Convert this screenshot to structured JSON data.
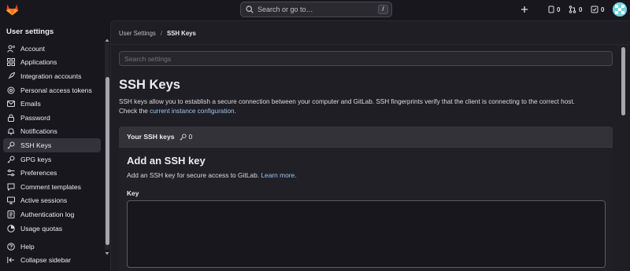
{
  "top_bar": {
    "search_placeholder": "Search or go to…",
    "search_shortcut": "/",
    "create_icon": "plus-icon",
    "merge_requests_count": "0",
    "issues_count": "0",
    "todos_count": "0"
  },
  "sidebar": {
    "title": "User settings",
    "items": [
      {
        "label": "Account",
        "icon": "account-icon"
      },
      {
        "label": "Applications",
        "icon": "applications-icon"
      },
      {
        "label": "Integration accounts",
        "icon": "rocket-icon"
      },
      {
        "label": "Personal access tokens",
        "icon": "token-icon"
      },
      {
        "label": "Emails",
        "icon": "mail-icon"
      },
      {
        "label": "Password",
        "icon": "lock-icon"
      },
      {
        "label": "Notifications",
        "icon": "bell-icon"
      },
      {
        "label": "SSH Keys",
        "icon": "key-icon",
        "active": true
      },
      {
        "label": "GPG keys",
        "icon": "key-icon"
      },
      {
        "label": "Preferences",
        "icon": "preferences-icon"
      },
      {
        "label": "Comment templates",
        "icon": "comment-icon"
      },
      {
        "label": "Active sessions",
        "icon": "monitor-icon"
      },
      {
        "label": "Authentication log",
        "icon": "log-icon"
      },
      {
        "label": "Usage quotas",
        "icon": "quota-icon"
      }
    ],
    "help": "Help",
    "collapse": "Collapse sidebar"
  },
  "main": {
    "breadcrumb": [
      "User Settings",
      "SSH Keys"
    ],
    "settings_search_placeholder": "Search settings",
    "title": "SSH Keys",
    "description": "SSH keys allow you to establish a secure connection between your computer and GitLab. SSH fingerprints verify that the client is connecting to the correct host.",
    "check_text": "Check the",
    "check_link": "current instance configuration",
    "check_end": ".",
    "card": {
      "header": "Your SSH keys",
      "key_count": "0",
      "add_title": "Add an SSH key",
      "add_desc": "Add an SSH key for secure access to GitLab.",
      "learn_more": "Learn more",
      "learn_more_end": ".",
      "key_label": "Key",
      "key_value": ""
    }
  },
  "colors": {
    "background": "#18171d",
    "panel": "#1f1e24",
    "link": "#9dc7f1",
    "logo_orange": "#e24329"
  }
}
